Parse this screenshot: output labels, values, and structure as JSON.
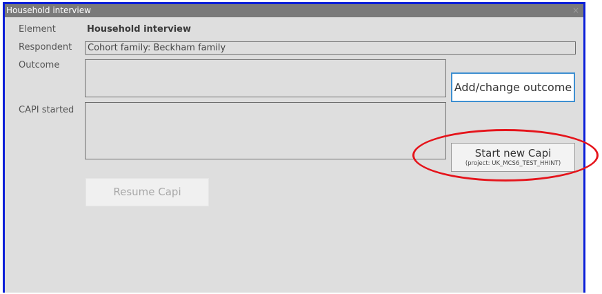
{
  "window": {
    "title": "Household interview",
    "close_glyph": "×"
  },
  "form": {
    "element_label": "Element",
    "element_value": "Household interview",
    "respondent_label": "Respondent",
    "respondent_value": "Cohort family: Beckham family",
    "outcome_label": "Outcome",
    "outcome_value": "",
    "capi_started_label": "CAPI started",
    "capi_started_value": ""
  },
  "buttons": {
    "add_change_outcome": "Add/change outcome",
    "start_new_capi": "Start new Capi",
    "start_new_capi_project": "(project: UK_MCS6_TEST_HHINT)",
    "resume_capi": "Resume Capi"
  },
  "colors": {
    "window_border": "#0b1ed8",
    "titlebar": "#7a7a7a",
    "panel_background": "#dedede",
    "outcome_button_border": "#3d8fd1",
    "highlight_ellipse": "#e5141b"
  }
}
